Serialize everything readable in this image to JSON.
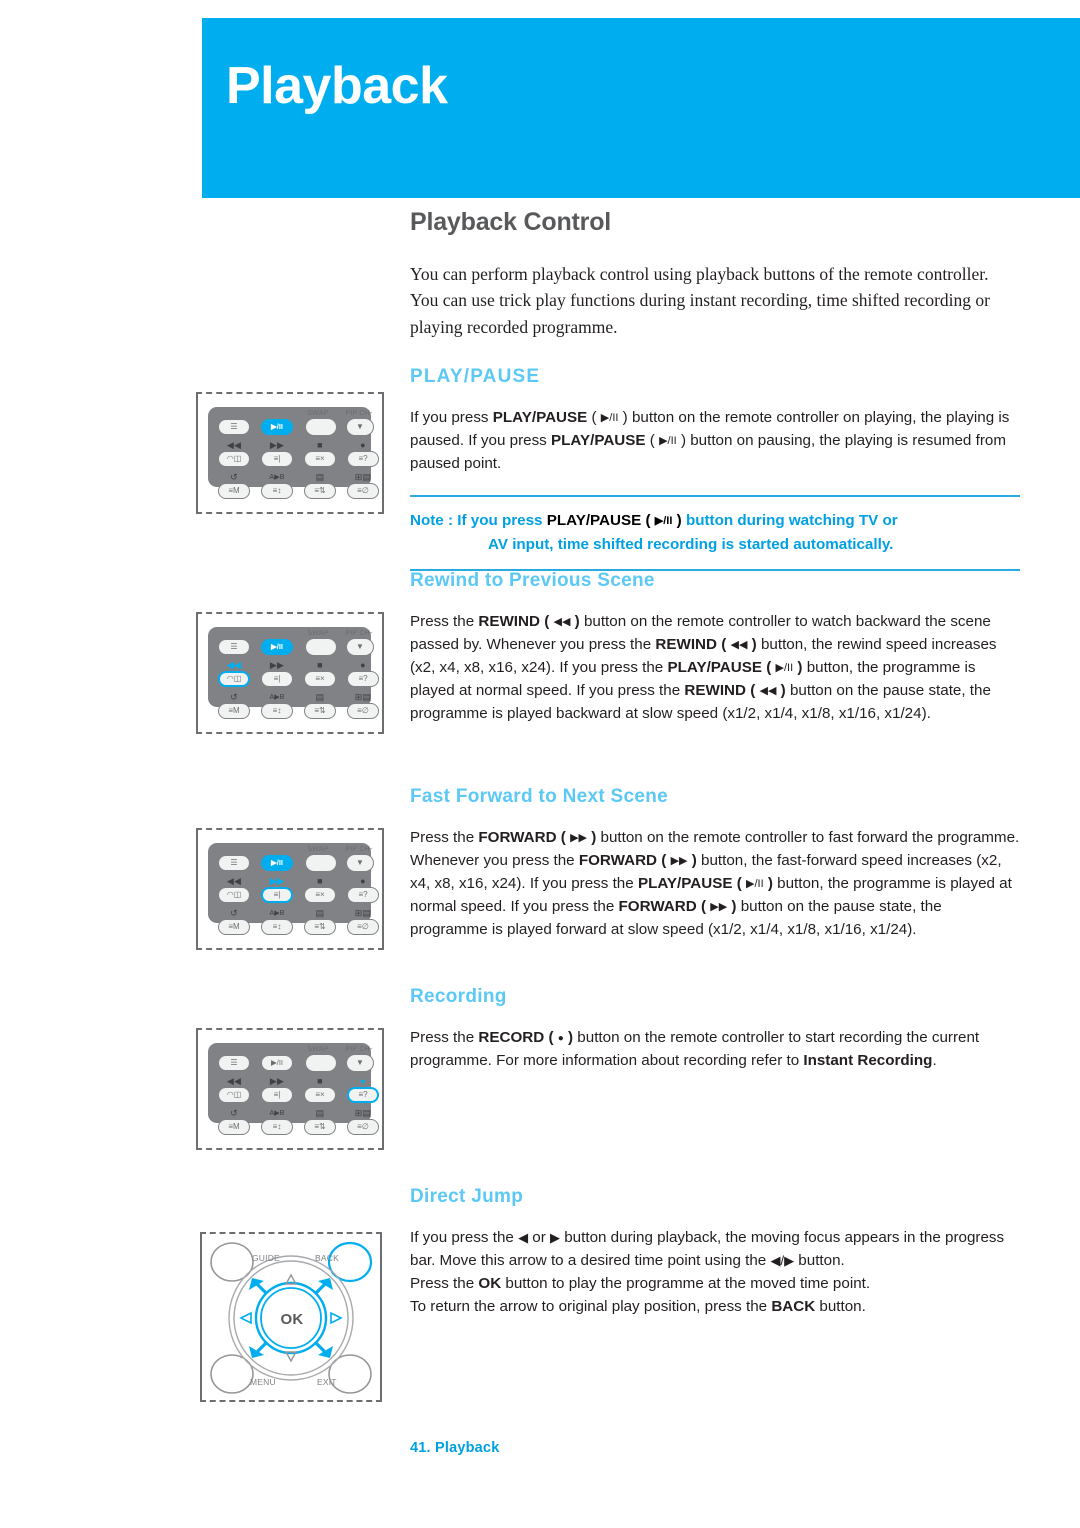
{
  "header": {
    "title": "Playback",
    "banner_color": "#00AEEF"
  },
  "page": {
    "section_title": "Playback Control",
    "intro": "You can perform playback control using playback buttons of the remote controller. You can use trick play functions during instant recording, time shifted recording or playing recorded programme.",
    "accent_color": "#5BC8F5",
    "note_border_color": "#29ABE2"
  },
  "sections": {
    "play_pause": {
      "heading": "PLAY/PAUSE",
      "text_1": "If you press ",
      "bold_1": "PLAY/PAUSE",
      "paren_open": "(",
      "glyph_playpause": "▶/II",
      "paren_close": ")",
      "text_2": " button on the remote controller on playing, the playing is paused. If you press ",
      "bold_2": "PLAY/PAUSE",
      "text_3": " button on pausing, the playing is resumed from paused point.",
      "note_label": "Note : If you press ",
      "note_bold": "PLAY/PAUSE",
      "note_text_1": " button during watching TV or",
      "note_text_2": "AV input, time shifted recording is started automatically."
    },
    "rewind": {
      "heading": "Rewind to Previous Scene",
      "glyph_rewind": "◀◀",
      "glyph_playpause": "▶/II",
      "t1": "Press the ",
      "b1": "REWIND",
      "t2": " button on the remote controller to watch backward the scene passed by. Whenever you press the ",
      "b2": "REWIND",
      "t3": " button, the rewind speed increases (x2, x4, x8, x16, x24). If you press the ",
      "b3": "PLAY/PAUSE",
      "t4": " button, the programme is played at normal speed. If you press the ",
      "b4": "REWIND",
      "t5": " button on the pause state, the programme is played backward at slow speed (x1/2, x1/4, x1/8, x1/16, x1/24)."
    },
    "forward": {
      "heading": "Fast Forward to Next Scene",
      "glyph_forward": "▶▶",
      "glyph_playpause": "▶/II",
      "t1": "Press the ",
      "b1": "FORWARD",
      "t2": " button on the remote controller to fast forward the programme. Whenever you press the ",
      "b2": "FORWARD",
      "t3": " button, the fast-forward speed increases (x2, x4, x8, x16, x24). If you press the ",
      "b3": "PLAY/PAUSE",
      "t4": " button, the programme is played at normal speed. If you press the ",
      "b4": "FORWARD",
      "t5": " button on the pause state, the programme is played forward at slow speed (x1/2, x1/4, x1/8, x1/16, x1/24)."
    },
    "recording": {
      "heading": "Recording",
      "glyph_record": "●",
      "t1": "Press the ",
      "b1": "RECORD",
      "t2": " button on the remote controller to start recording the current programme. For more information about recording refer to ",
      "b2": "Instant Recording",
      "t3": "."
    },
    "direct_jump": {
      "heading": "Direct Jump",
      "glyph_left": "◀",
      "glyph_right": "▶",
      "glyph_leftright": "◀/▶",
      "t1": "If you press the ",
      "t2": " or ",
      "t3": " button during playback, the moving focus appears in the progress bar. Move this arrow to a desired time point using the ",
      "t4": " button.",
      "t5": "Press the ",
      "b1": "OK",
      "t6": " button to play the programme at the moved time point.",
      "t7": "To return the arrow to original play position, press the ",
      "b2": "BACK",
      "t8": " button."
    }
  },
  "remote": {
    "labels": {
      "swap": "SWAP",
      "pip_ch": "PIP CH-",
      "rewind": "◀◀",
      "forward": "▶▶",
      "stop": "■",
      "record": "●",
      "replay": "↺",
      "ab": "A▶B",
      "split": "⌸",
      "add": "⊞",
      "playpause": "▶/II",
      "menu_btn": "☰"
    },
    "dpad": {
      "guide": "GUIDE",
      "back": "BACK",
      "menu": "MENU",
      "exit": "EXIT",
      "ok": "OK",
      "up": "△",
      "down": "▽",
      "left": "◁",
      "right": "▷"
    }
  },
  "footer": {
    "text": "41. Playback"
  }
}
